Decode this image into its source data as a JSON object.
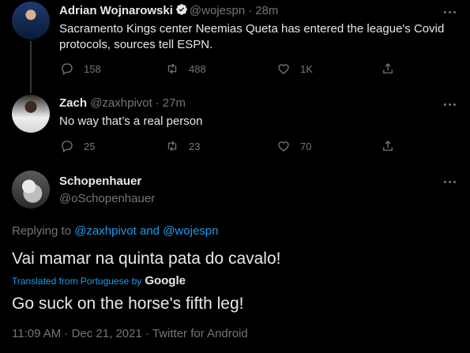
{
  "tweets": [
    {
      "name": "Adrian Wojnarowski",
      "handle": "@wojespn",
      "time": "28m",
      "verified": true,
      "text": "Sacramento Kings center Neemias Queta has entered the league's Covid protocols, sources tell ESPN.",
      "replies": "158",
      "retweets": "488",
      "likes": "1K"
    },
    {
      "name": "Zach",
      "handle": "@zaxhpivot",
      "time": "27m",
      "verified": false,
      "text": "No way that’s a real person",
      "replies": "25",
      "retweets": "23",
      "likes": "70"
    }
  ],
  "main_tweet": {
    "name": "Schopenhauer",
    "handle": "@oSchopenhauer",
    "replying_prefix": "Replying to",
    "replying_to_1": "@zaxhpivot",
    "replying_and": "and",
    "replying_to_2": "@wojespn",
    "original_text": "Vai mamar na quinta pata do cavalo!",
    "translated_label": "Translated from Portuguese by",
    "translator": "Google",
    "translated_text": "Go suck on the horse's fifth leg!",
    "timestamp": "11:09 AM · Dec 21, 2021 · Twitter for Android"
  },
  "colors": {
    "background": "#000000",
    "text": "#e7e9ea",
    "muted": "#71767b",
    "accent": "#1d9bf0"
  },
  "icons": [
    "verified-badge-icon",
    "more-icon",
    "reply-icon",
    "retweet-icon",
    "like-icon",
    "share-icon"
  ]
}
